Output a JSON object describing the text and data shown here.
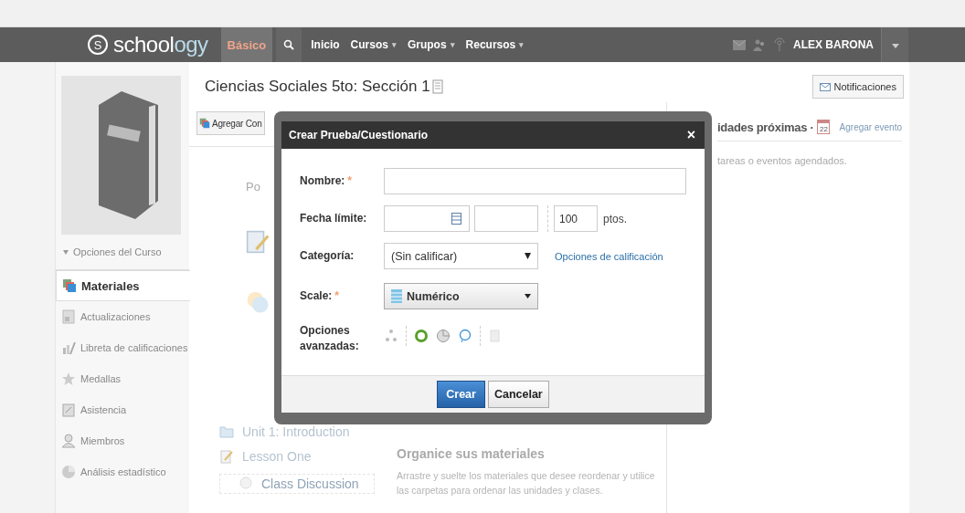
{
  "nav": {
    "logo_mark": "S",
    "logo_text": "school",
    "logo_text_accent": "ogy",
    "plan_badge": "Básico",
    "items": [
      {
        "label": "Inicio",
        "has_menu": false
      },
      {
        "label": "Cursos",
        "has_menu": true
      },
      {
        "label": "Grupos",
        "has_menu": true
      },
      {
        "label": "Recursos",
        "has_menu": true
      }
    ],
    "menu_caret": "▾",
    "user_name": "ALEX BARONA"
  },
  "course": {
    "title": "Ciencias Sociales 5to: Sección 1",
    "notifications_button": "Notificaciones",
    "options_label": "Opciones del Curso"
  },
  "sidebar": {
    "items": [
      {
        "label": "Materiales",
        "selected": true
      },
      {
        "label": "Actualizaciones",
        "selected": false
      },
      {
        "label": "Libreta de calificaciones",
        "selected": false
      },
      {
        "label": "Medallas",
        "selected": false
      },
      {
        "label": "Asistencia",
        "selected": false
      },
      {
        "label": "Miembros",
        "selected": false
      },
      {
        "label": "Análisis estadístico",
        "selected": false
      }
    ]
  },
  "main": {
    "add_button": "Agregar Con",
    "hint_text": "Po",
    "materials": [
      {
        "kind": "folder",
        "label": "Unit 1: Introduction"
      },
      {
        "kind": "assignment",
        "label": "Lesson One"
      },
      {
        "kind": "discussion",
        "label": "Class Discussion"
      }
    ],
    "organize_title": "Organice sus materiales",
    "organize_text": "Arrastre y suelte los materiales que desee reordenar y utilice las carpetas para ordenar las unidades y clases."
  },
  "upcoming": {
    "title": "idades próximas ·",
    "calendar_day": "22",
    "add_event": "Agregar evento",
    "empty_text": "tareas o eventos agendados."
  },
  "dialog": {
    "title": "Crear Prueba/Cuestionario",
    "close": "×",
    "name_label": "Nombre:",
    "name_required": "*",
    "due_label": "Fecha límite:",
    "points_value": "100",
    "points_unit": "ptos.",
    "category_label": "Categoría:",
    "category_value": "(Sin calificar)",
    "grading_link": "Opciones de calificación",
    "scale_label": "Scale:",
    "scale_required": "*",
    "scale_value": "Numérico",
    "advanced_label": "Opciones avanzadas:",
    "create_button": "Crear",
    "cancel_button": "Cancelar"
  }
}
